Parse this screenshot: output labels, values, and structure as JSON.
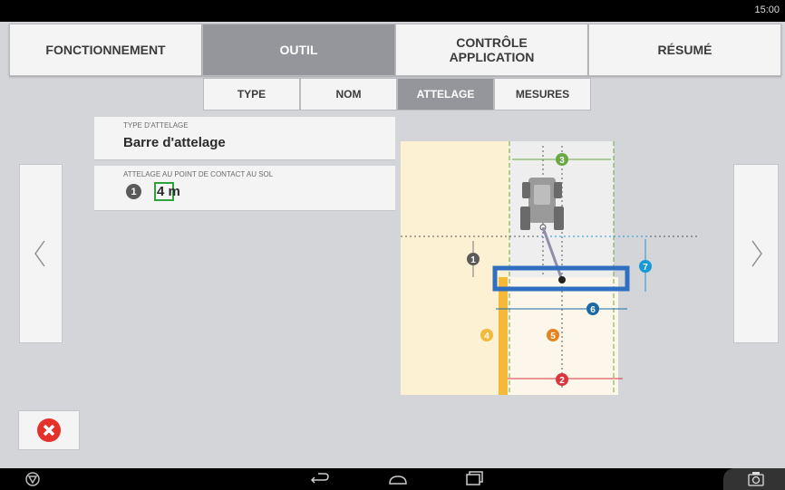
{
  "status": {
    "time": "15:00"
  },
  "tabs": [
    {
      "label": "FONCTIONNEMENT"
    },
    {
      "label": "OUTIL"
    },
    {
      "label_line1": "CONTRÔLE",
      "label_line2": "APPLICATION"
    },
    {
      "label": "RÉSUMÉ"
    }
  ],
  "subtabs": [
    {
      "label": "TYPE"
    },
    {
      "label": "NOM"
    },
    {
      "label": "ATTELAGE"
    },
    {
      "label": "MESURES"
    }
  ],
  "fields": {
    "hitch_type": {
      "label": "TYPE D'ATTELAGE",
      "value": "Barre d'attelage"
    },
    "hitch_distance": {
      "label": "ATTELAGE AU POINT DE CONTACT AU SOL",
      "badge": "1",
      "value": "4 m"
    }
  },
  "diagram": {
    "markers": [
      "1",
      "2",
      "3",
      "4",
      "5",
      "6",
      "7"
    ]
  },
  "colors": {
    "active_tab": "#95969b",
    "cancel": "#e5312a",
    "tool_bar": "#2f6fc1",
    "field_edge": "#f5b937",
    "marker_green": "#6aa844",
    "marker_red": "#d9363e",
    "marker_blue": "#1b6aa8",
    "marker_cyan": "#1799d6",
    "marker_orange": "#e8821e",
    "marker_gray": "#5b5b5b"
  },
  "icons": {
    "prev": "chevron-left-icon",
    "next": "chevron-right-icon",
    "cancel": "cancel-x-icon",
    "screenshot": "camera-icon"
  }
}
